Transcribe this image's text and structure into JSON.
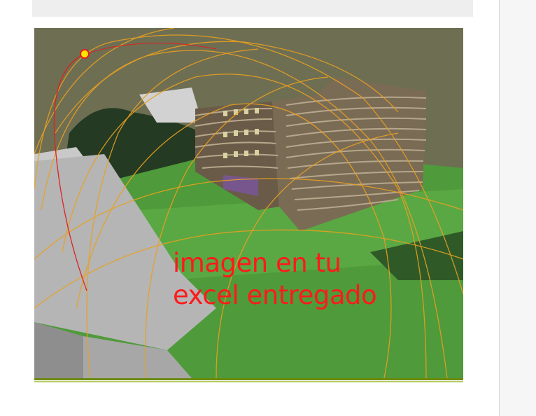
{
  "caption": {
    "line1": "imagen en tu",
    "line2": "excel entregado"
  },
  "colors": {
    "caption_text": "#ff1a1a",
    "sun_path": "#e8a020",
    "sun_marker": "#ffe600",
    "ground": "#4f9a3a",
    "building": "#7a6b55",
    "sky": "#6e6e53",
    "divider": "#6a8a0c"
  },
  "scene": {
    "description_icon": "sun-marker-icon"
  }
}
